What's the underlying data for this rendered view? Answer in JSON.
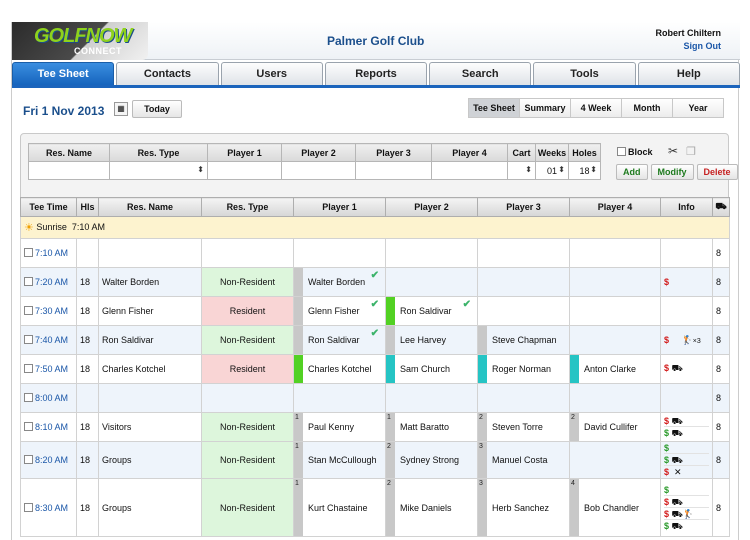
{
  "header": {
    "logo_main": "GOLFNOW",
    "logo_sub": "CONNECT",
    "club": "Palmer Golf Club",
    "user": "Robert Chiltern",
    "sign_out": "Sign Out"
  },
  "nav": {
    "tabs": [
      "Tee Sheet",
      "Contacts",
      "Users",
      "Reports",
      "Search",
      "Tools",
      "Help"
    ],
    "active": "Tee Sheet"
  },
  "datebar": {
    "date": "Fri 1 Nov 2013",
    "today": "Today",
    "views": [
      "Tee Sheet",
      "Summary",
      "4 Week",
      "Month",
      "Year"
    ],
    "active_view": "Tee Sheet"
  },
  "form": {
    "headers": [
      "Res. Name",
      "Res. Type",
      "Player 1",
      "Player 2",
      "Player 3",
      "Player 4",
      "Cart",
      "Weeks",
      "Holes"
    ],
    "weeks_value": "01",
    "holes_value": "18",
    "block_label": "Block",
    "buttons": {
      "add": "Add",
      "modify": "Modify",
      "delete": "Delete"
    }
  },
  "grid": {
    "headers": [
      "Tee Time",
      "Hls",
      "Res. Name",
      "Res. Type",
      "Player 1",
      "Player 2",
      "Player 3",
      "Player 4",
      "Info"
    ],
    "sunrise_label": "Sunrise",
    "sunrise_time": "7:10 AM",
    "rows": [
      {
        "time": "7:10 AM",
        "hls": "",
        "name": "",
        "type": "",
        "p1": "",
        "p2": "",
        "p3": "",
        "p4": "",
        "count": "8"
      },
      {
        "time": "7:20 AM",
        "hls": "18",
        "name": "Walter Borden",
        "type": "Non-Resident",
        "p1": "Walter Borden",
        "p2": "",
        "p3": "",
        "p4": "",
        "count": "8"
      },
      {
        "time": "7:30 AM",
        "hls": "18",
        "name": "Glenn Fisher",
        "type": "Resident",
        "p1": "Glenn Fisher",
        "p2": "Ron Saldivar",
        "p3": "",
        "p4": "",
        "count": "8"
      },
      {
        "time": "7:40 AM",
        "hls": "18",
        "name": "Ron Saldivar",
        "type": "Non-Resident",
        "p1": "Ron Saldivar",
        "p2": "Lee Harvey",
        "p3": "Steve Chapman",
        "p4": "",
        "count": "8",
        "info_extra": "×3"
      },
      {
        "time": "7:50 AM",
        "hls": "18",
        "name": "Charles Kotchel",
        "type": "Resident",
        "p1": "Charles Kotchel",
        "p2": "Sam Church",
        "p3": "Roger Norman",
        "p4": "Anton Clarke",
        "count": "8"
      },
      {
        "time": "8:00 AM",
        "hls": "",
        "name": "",
        "type": "",
        "p1": "",
        "p2": "",
        "p3": "",
        "p4": "",
        "count": "8"
      },
      {
        "time": "8:10 AM",
        "hls": "18",
        "name": "Visitors",
        "type": "Non-Resident",
        "p1": "Paul Kenny",
        "p2": "Matt Baratto",
        "p3": "Steven Torre",
        "p4": "David Cullifer",
        "count": "8",
        "nums": [
          "1",
          "1",
          "2",
          "2"
        ]
      },
      {
        "time": "8:20 AM",
        "hls": "18",
        "name": "Groups",
        "type": "Non-Resident",
        "p1": "Stan McCullough",
        "p2": "Sydney Strong",
        "p3": "Manuel Costa",
        "p4": "",
        "count": "8",
        "nums": [
          "1",
          "2",
          "3",
          ""
        ]
      },
      {
        "time": "8:30 AM",
        "hls": "18",
        "name": "Groups",
        "type": "Non-Resident",
        "p1": "Kurt Chastaine",
        "p2": "Mike Daniels",
        "p3": "Herb Sanchez",
        "p4": "Bob Chandler",
        "count": "8",
        "nums": [
          "1",
          "2",
          "3",
          "4"
        ]
      }
    ],
    "dollar": "$"
  },
  "colors": {
    "accent": "#1b64bc",
    "resident": "#f9d5d5",
    "non_resident": "#ddf6dc",
    "check": "#3bb36a",
    "dollar_red": "#d21a1a",
    "dollar_green": "#2a9a2a"
  }
}
